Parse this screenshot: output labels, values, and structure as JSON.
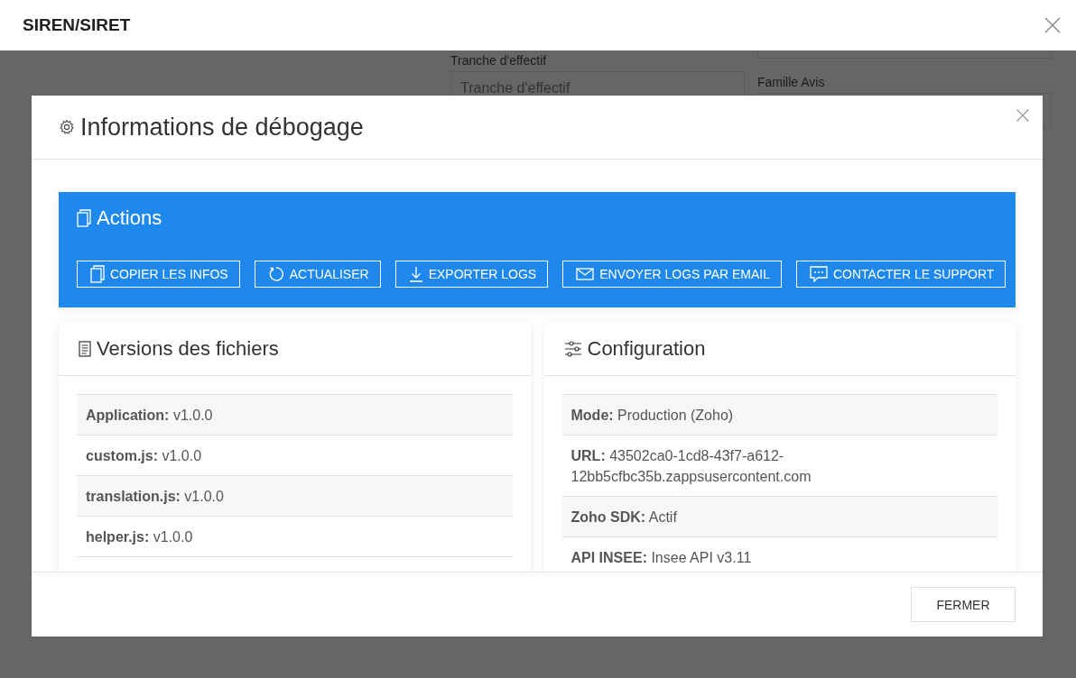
{
  "header": {
    "title": "SIREN/SIRET"
  },
  "background_form": {
    "left_field": {
      "label": "Tranche d'effectif",
      "placeholder": "Tranche d'effectif"
    },
    "right_field": {
      "label": "Famille Avis"
    }
  },
  "dialog": {
    "title": "Informations de débogage",
    "actions": {
      "title": "Actions",
      "buttons": [
        {
          "kind": "copy",
          "label": "COPIER LES INFOS"
        },
        {
          "kind": "refresh",
          "label": "ACTUALISER"
        },
        {
          "kind": "download",
          "label": "EXPORTER LOGS"
        },
        {
          "kind": "mail",
          "label": "ENVOYER LOGS PAR EMAIL"
        },
        {
          "kind": "chat",
          "label": "CONTACTER LE SUPPORT"
        }
      ]
    },
    "versions": {
      "title": "Versions des fichiers",
      "rows": [
        {
          "label": "Application:",
          "value": "v1.0.0"
        },
        {
          "label": "custom.js:",
          "value": "v1.0.0"
        },
        {
          "label": "translation.js:",
          "value": "v1.0.0"
        },
        {
          "label": "helper.js:",
          "value": "v1.0.0"
        }
      ]
    },
    "configuration": {
      "title": "Configuration",
      "rows": [
        {
          "label": "Mode:",
          "value": "Production (Zoho)"
        },
        {
          "label": "URL:",
          "value": "43502ca0-1cd8-43f7-a612-12bb5cfbc35b.zappsusercontent.com"
        },
        {
          "label": "Zoho SDK:",
          "value": "Actif"
        },
        {
          "label": "API INSEE:",
          "value": "Insee API v3.11"
        }
      ]
    },
    "footer_button": "FERMER"
  }
}
